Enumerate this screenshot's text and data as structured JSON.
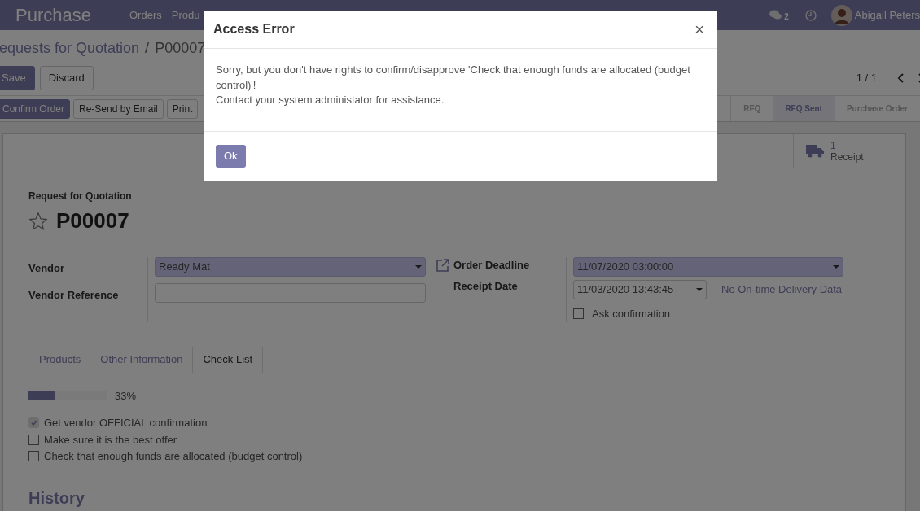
{
  "navbar": {
    "app_name": "Purchase",
    "menu": [
      "Orders",
      "Produ"
    ],
    "chat_count": "2",
    "user": "Abigail Peters"
  },
  "breadcrumb": {
    "items": [
      "equests for Quotation",
      "P00007"
    ],
    "separator": "/"
  },
  "edit_buttons": [
    {
      "label": "Save",
      "primary": true
    },
    {
      "label": "Discard",
      "primary": false
    }
  ],
  "pager": "1 / 1",
  "actions": [
    {
      "label": "Confirm Order",
      "primary": true
    },
    {
      "label": "Re-Send by Email",
      "primary": false
    },
    {
      "label": "Print",
      "primary": false
    }
  ],
  "stages": [
    {
      "label": "RFQ",
      "selected": false
    },
    {
      "label": "RFQ Sent",
      "selected": true
    },
    {
      "label": "Purchase Order",
      "selected": false
    }
  ],
  "smart_button": {
    "count": "1",
    "label": "Receipt"
  },
  "form": {
    "subtitle": "Request for Quotation",
    "name": "P00007",
    "starred": false,
    "left_fields": [
      {
        "label": "Vendor",
        "value": "Ready Mat",
        "kind": "select",
        "required": true
      },
      {
        "label": "Vendor Reference",
        "kind": "text",
        "required": false
      }
    ],
    "right_fields": [
      {
        "label": "Order Deadline",
        "value": "11/07/2020 03:00:00",
        "kind": "select",
        "required": true
      },
      {
        "label": "Receipt Date",
        "value": "11/03/2020 13:43:45",
        "kind": "date",
        "required": false,
        "note": "No On-time Delivery Data"
      }
    ],
    "ask_confirmation": {
      "label": "Ask confirmation",
      "checked": false
    }
  },
  "tabs": [
    {
      "label": "Products",
      "selected": false
    },
    {
      "label": "Other Information",
      "selected": false
    },
    {
      "label": "Check List",
      "selected": true
    }
  ],
  "progress": {
    "level": 0.33,
    "reading": "33%"
  },
  "checklist": [
    {
      "label": "Get vendor OFFICIAL confirmation",
      "checked": true
    },
    {
      "label": "Make sure it is the best offer",
      "checked": false
    },
    {
      "label": "Check that enough funds are allocated (budget control)",
      "checked": false
    }
  ],
  "history_title": "History",
  "dialog": {
    "title": "Access Error",
    "close": "×",
    "message": [
      "Sorry, but you don't have rights to confirm/disapprove 'Check that enough funds are allocated (budget control)'!",
      "Contact your system administator for assistance."
    ],
    "button": "Ok"
  }
}
